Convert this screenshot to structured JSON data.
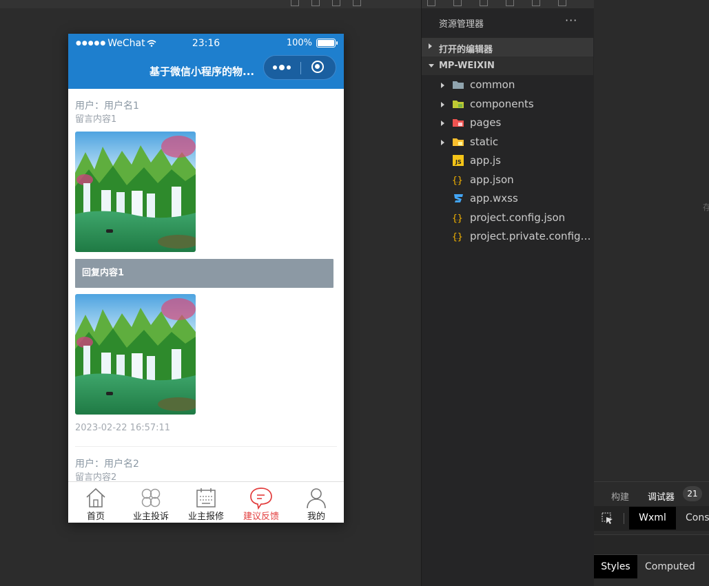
{
  "statusbar": {
    "carrier": "WeChat",
    "time": "23:16",
    "battery": "100%"
  },
  "navbar": {
    "title": "基于微信小程序的物..."
  },
  "messages": [
    {
      "user": "用户：用户名1",
      "content": "留言内容1",
      "reply": "回复内容1",
      "time": "2023-02-22 16:57:11"
    },
    {
      "user": "用户：用户名2",
      "content": "留言内容2"
    }
  ],
  "tabbar": [
    {
      "label": "首页",
      "icon": "home-icon"
    },
    {
      "label": "业主投诉",
      "icon": "clover-icon"
    },
    {
      "label": "业主报修",
      "icon": "keyboard-icon"
    },
    {
      "label": "建议反馈",
      "icon": "chat-bubble-icon",
      "active": true
    },
    {
      "label": "我的",
      "icon": "person-icon"
    }
  ],
  "explorer": {
    "title": "资源管理器",
    "more": "···",
    "open_editors": "打开的编辑器",
    "project": "MP-WEIXIN",
    "items": [
      {
        "name": "common",
        "type": "folder"
      },
      {
        "name": "components",
        "type": "folder"
      },
      {
        "name": "pages",
        "type": "folder"
      },
      {
        "name": "static",
        "type": "folder"
      },
      {
        "name": "app.js",
        "type": "js"
      },
      {
        "name": "app.json",
        "type": "json"
      },
      {
        "name": "app.wxss",
        "type": "css"
      },
      {
        "name": "project.config.json",
        "type": "json"
      },
      {
        "name": "project.private.config.js...",
        "type": "json"
      }
    ]
  },
  "devtools": {
    "tab_build": "构建",
    "tab_debugger": "调试器",
    "badge": "21",
    "panel_wxml": "Wxml",
    "panel_console": "Cons",
    "styles": "Styles",
    "computed": "Computed",
    "edge_char": "存"
  },
  "colors": {
    "nav_blue": "#1e7fce",
    "active_red": "#e23c3c",
    "reply_bg": "#8c99a4"
  }
}
